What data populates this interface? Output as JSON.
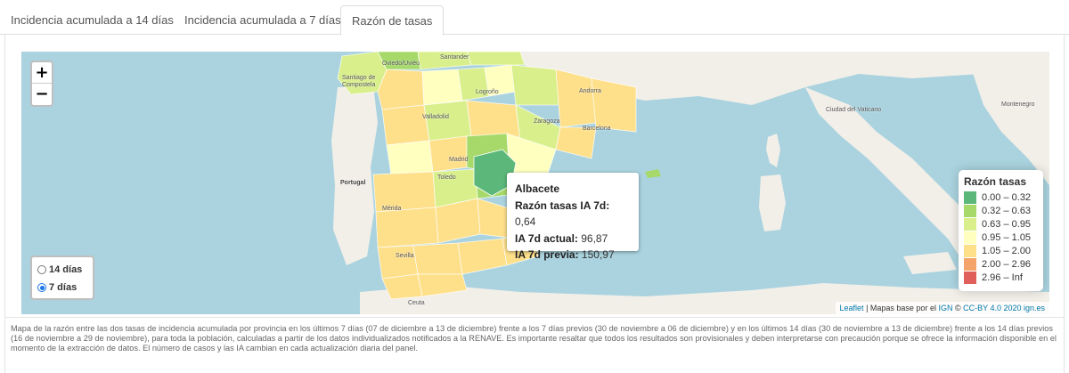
{
  "tabs": [
    {
      "label": "Incidencia acumulada a 14 días",
      "active": false
    },
    {
      "label": "Incidencia acumulada a 7 días",
      "active": false
    },
    {
      "label": "Razón de tasas",
      "active": true
    }
  ],
  "map": {
    "zoom_in_label": "+",
    "zoom_out_label": "−",
    "radio_options": [
      {
        "label": "14 días",
        "checked": false
      },
      {
        "label": "7 días",
        "checked": true
      }
    ],
    "place_labels": {
      "santander": "Santander",
      "oviedo": "Oviedo/Uviéu",
      "santiago": "Santiago de Compostela",
      "andorra": "Andorra",
      "zaragoza": "Zaragoza",
      "barcelona": "Barcelona",
      "madrid": "Madrid",
      "toledo": "Toledo",
      "merida": "Mérida",
      "sevilla": "Sevilla",
      "ceuta": "Ceuta",
      "portugal": "Portugal",
      "vaticano": "Ciudad del Vaticano",
      "montenegro": "Montenegro",
      "valladolid": "Valladolid",
      "logrono": "Logroño"
    },
    "tooltip": {
      "province": "Albacete",
      "ratio_label": "Razón tasas IA 7d:",
      "ratio_value": "0,64",
      "current_label": "IA 7d actual:",
      "current_value": "96,87",
      "previous_label": "IA 7d previa:",
      "previous_value": "150,97"
    },
    "legend": {
      "title": "Razón tasas",
      "items": [
        {
          "label": "0.00 – 0.32",
          "color": "#5cb87a"
        },
        {
          "label": "0.32 – 0.63",
          "color": "#a6d96a"
        },
        {
          "label": "0.63 – 0.95",
          "color": "#d9ef8b"
        },
        {
          "label": "0.95 – 1.05",
          "color": "#ffffbf"
        },
        {
          "label": "1.05 – 2.00",
          "color": "#fee08b"
        },
        {
          "label": "2.00 – 2.96",
          "color": "#f4a36a"
        },
        {
          "label": "2.96 – Inf",
          "color": "#e05f5a"
        }
      ]
    },
    "attribution": {
      "leaflet": "Leaflet",
      "text1": " | Mapas base por el ",
      "ign": "IGN",
      "text2": " © ",
      "license": "CC-BY 4.0 2020 ign.es"
    }
  },
  "caption": "Mapa de la razón entre las dos tasas de incidencia acumulada por provincia en los últimos 7 días (07 de diciembre a 13 de diciembre) frente a los 7 días previos (30 de noviembre a 06 de diciembre) y en los últimos 14 días (30 de noviembre a 13 de diciembre) frente a los 14 días previos (16 de noviembre a 29 de noviembre), para toda la población, calculadas a partir de los datos individualizados notificados a la RENAVE. Es importante resaltar que todos los resultados son provisionales y deben interpretarse con precaución porque se ofrece la información disponible en el momento de la extracción de datos. El número de casos y las IA cambian en cada actualización diaria del panel."
}
